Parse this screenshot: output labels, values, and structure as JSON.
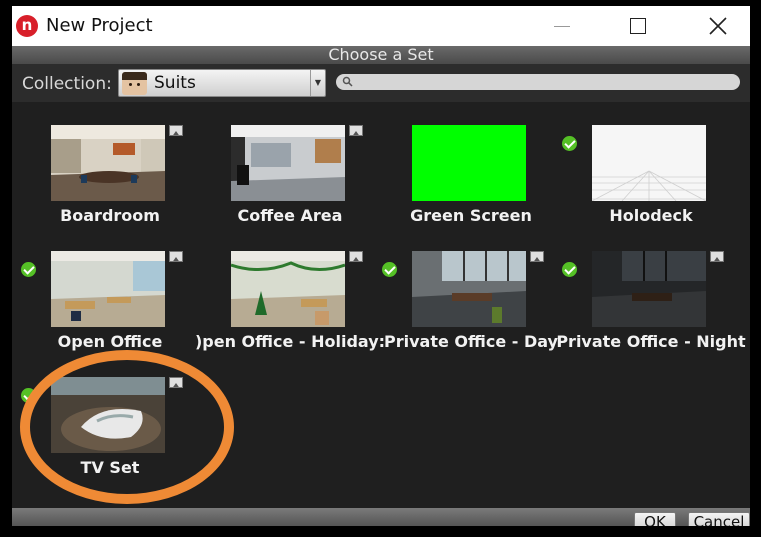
{
  "window": {
    "title": "New Project",
    "app_icon_letter": "n",
    "app_icon_color": "#d81f2a"
  },
  "header": {
    "title": "Choose a Set"
  },
  "toolbar": {
    "collection_label": "Collection:",
    "collection_value": "Suits",
    "search_placeholder": ""
  },
  "sets": [
    {
      "label": "Boardroom",
      "installed": false,
      "icon": "image-icon"
    },
    {
      "label": "Coffee Area",
      "installed": false,
      "icon": "image-icon"
    },
    {
      "label": "Green Screen",
      "installed": false,
      "icon": "none"
    },
    {
      "label": "Holodeck",
      "installed": true,
      "icon": "none"
    },
    {
      "label": "Open Office",
      "installed": true,
      "icon": "image-icon"
    },
    {
      "label": ")pen Office - Holiday:",
      "installed": false,
      "icon": "image-icon"
    },
    {
      "label": "Private Office - Day",
      "installed": true,
      "icon": "image-icon"
    },
    {
      "label": "Private Office - Night",
      "installed": true,
      "icon": "image-icon"
    },
    {
      "label": "TV Set",
      "installed": true,
      "icon": "image-icon"
    }
  ],
  "footer": {
    "ok_label": "OK",
    "cancel_label": "Cancel"
  },
  "colors": {
    "accent_check": "#55c026",
    "annotation": "#ef8a35",
    "green_screen": "#00ff00"
  }
}
